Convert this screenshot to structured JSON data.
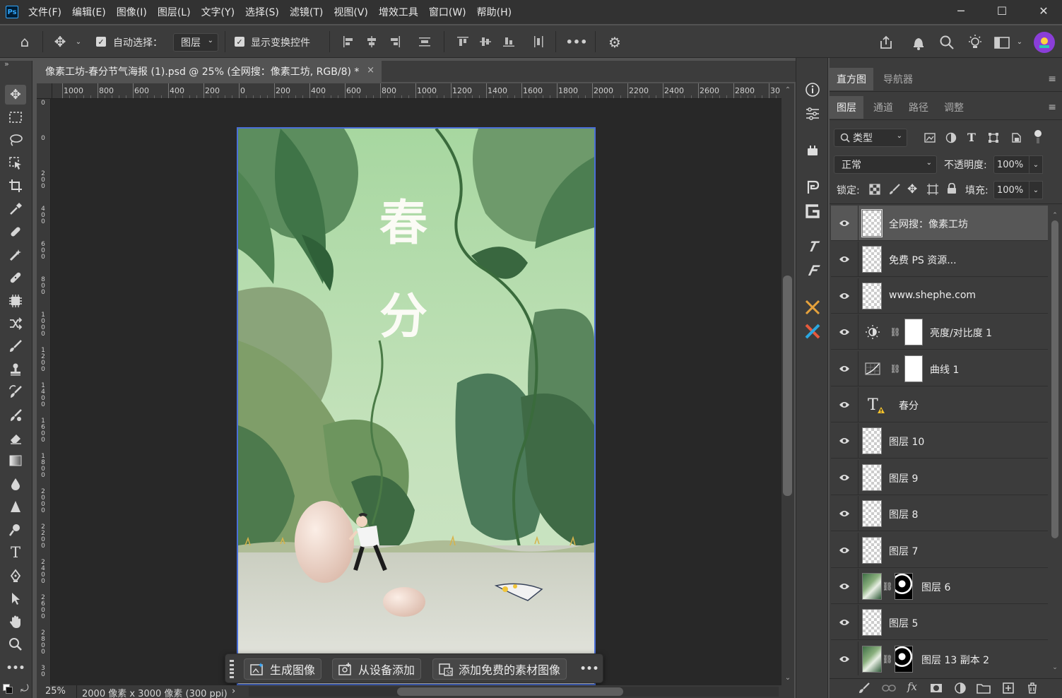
{
  "app": {
    "logo": "Ps"
  },
  "menubar": {
    "items": [
      "文件(F)",
      "编辑(E)",
      "图像(I)",
      "图层(L)",
      "文字(Y)",
      "选择(S)",
      "滤镜(T)",
      "视图(V)",
      "增效工具",
      "窗口(W)",
      "帮助(H)"
    ]
  },
  "options": {
    "auto_select_label": "自动选择：",
    "auto_select_value": "图层",
    "show_transform_label": "显示变换控件",
    "more": "•••"
  },
  "document": {
    "tab_title": "像素工坊-春分节气海报 (1).psd @ 25% (全网搜：像素工坊, RGB/8) *",
    "close": "×"
  },
  "ruler": {
    "h_labels": [
      "1000",
      "800",
      "600",
      "400",
      "200",
      "0",
      "200",
      "400",
      "600",
      "800",
      "1000",
      "1200",
      "1400",
      "1600",
      "1800",
      "2000",
      "2200",
      "2400",
      "2600",
      "2800",
      "30"
    ],
    "v_labels": [
      "0",
      "0",
      "2 0 0",
      "4 0 0",
      "6 0 0",
      "8 0 0",
      "1 0 0 0",
      "1 2 0 0",
      "1 4 0 0",
      "1 6 0 0",
      "1 8 0 0",
      "2 0 0 0",
      "2 2 0 0",
      "2 4 0 0",
      "2 6 0 0",
      "2 8 0 0",
      "3 0"
    ]
  },
  "artwork": {
    "title_char_1": "春",
    "title_char_2": "分"
  },
  "taskbar": {
    "generate": "生成图像",
    "from_device": "从设备添加",
    "add_free": "添加免费的素材图像",
    "more": "•••"
  },
  "status": {
    "zoom": "25%",
    "doc_info": "2000 像素 x 3000 像素 (300 ppi)",
    "arrow": "›"
  },
  "panels": {
    "top_tabs": [
      "直方图",
      "导航器"
    ],
    "layer_tabs": [
      "图层",
      "通道",
      "路径",
      "调整"
    ],
    "filter_label": "类型",
    "blend_mode": "正常",
    "opacity_label": "不透明度:",
    "opacity_value": "100%",
    "lock_label": "锁定:",
    "fill_label": "填充:",
    "fill_value": "100%"
  },
  "layers": [
    {
      "name": "全网搜：像素工坊",
      "kind": "pixel",
      "selected": true
    },
    {
      "name": "免费 PS 资源...",
      "kind": "pixel"
    },
    {
      "name": "www.shephe.com",
      "kind": "pixel"
    },
    {
      "name": "亮度/对比度 1",
      "kind": "adjust-brightness"
    },
    {
      "name": "曲线 1",
      "kind": "adjust-curves"
    },
    {
      "name": "春分",
      "kind": "text"
    },
    {
      "name": "图层 10",
      "kind": "pixel"
    },
    {
      "name": "图层 9",
      "kind": "pixel"
    },
    {
      "name": "图层 8",
      "kind": "pixel"
    },
    {
      "name": "图层 7",
      "kind": "pixel"
    },
    {
      "name": "图层 6",
      "kind": "masked"
    },
    {
      "name": "图层 5",
      "kind": "pixel"
    },
    {
      "name": "图层 13 副本 2",
      "kind": "masked"
    }
  ],
  "colors": {
    "accent": "#31a8ff",
    "selection_border": "#4a6fd8"
  }
}
